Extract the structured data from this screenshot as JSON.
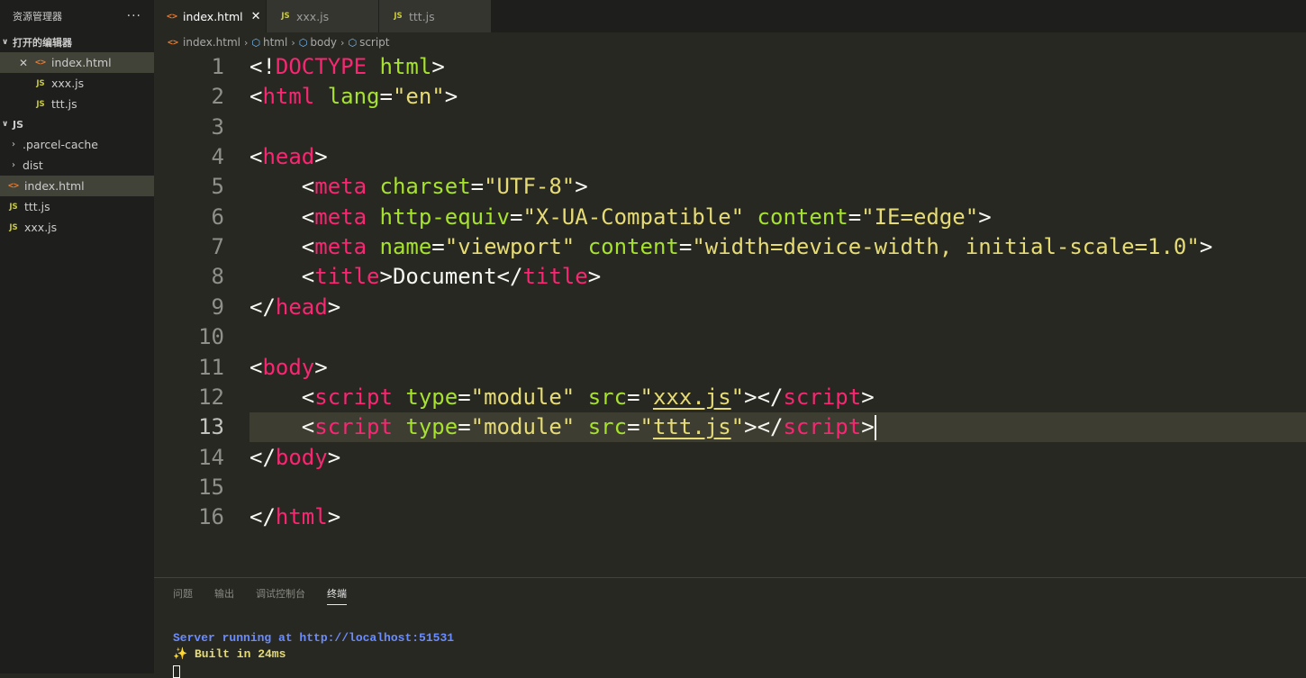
{
  "sidebar": {
    "title": "资源管理器",
    "more": "···",
    "open_editors": {
      "title": "打开的编辑器",
      "items": [
        {
          "name": "index.html",
          "icon": "<>",
          "close": "✕"
        },
        {
          "name": "xxx.js",
          "icon": "JS"
        },
        {
          "name": "ttt.js",
          "icon": "JS"
        }
      ]
    },
    "folder": {
      "title": "JS",
      "items": [
        {
          "name": ".parcel-cache"
        },
        {
          "name": "dist"
        },
        {
          "name": "index.html",
          "icon": "<>"
        },
        {
          "name": "ttt.js",
          "icon": "JS"
        },
        {
          "name": "xxx.js",
          "icon": "JS"
        }
      ]
    }
  },
  "tabs": [
    {
      "label": "index.html",
      "icon": "<>",
      "close": "✕"
    },
    {
      "label": "xxx.js",
      "icon": "JS"
    },
    {
      "label": "ttt.js",
      "icon": "JS"
    }
  ],
  "breadcrumb": [
    "index.html",
    "html",
    "body",
    "script"
  ],
  "editor": {
    "line_numbers": [
      "1",
      "2",
      "3",
      "4",
      "5",
      "6",
      "7",
      "8",
      "9",
      "10",
      "11",
      "12",
      "13",
      "14",
      "15",
      "16"
    ],
    "current_line": "13",
    "lines": [
      [
        "<!",
        "DOCTYPE",
        " ",
        "html",
        ">"
      ],
      [
        "<",
        "html",
        " ",
        "lang",
        "=",
        "\"en\"",
        ">"
      ],
      [],
      [
        "<",
        "head",
        ">"
      ],
      [
        "    <",
        "meta",
        " ",
        "charset",
        "=",
        "\"UTF-8\"",
        ">"
      ],
      [
        "    <",
        "meta",
        " ",
        "http-equiv",
        "=",
        "\"X-UA-Compatible\"",
        " ",
        "content",
        "=",
        "\"IE=edge\"",
        ">"
      ],
      [
        "    <",
        "meta",
        " ",
        "name",
        "=",
        "\"viewport\"",
        " ",
        "content",
        "=",
        "\"width=device-width, initial-scale=1.0\"",
        ">"
      ],
      [
        "    <",
        "title",
        ">",
        "Document",
        "</",
        "title",
        ">"
      ],
      [
        "</",
        "head",
        ">"
      ],
      [],
      [
        "<",
        "body",
        ">"
      ],
      [
        "    <",
        "script",
        " ",
        "type",
        "=",
        "\"module\"",
        " ",
        "src",
        "=",
        "\"",
        "xxx.js",
        "\"",
        "></",
        "script",
        ">"
      ],
      [
        "    <",
        "script",
        " ",
        "type",
        "=",
        "\"module\"",
        " ",
        "src",
        "=",
        "\"",
        "ttt.js",
        "\"",
        "></",
        "script",
        ">"
      ],
      [
        "</",
        "body",
        ">"
      ],
      [],
      [
        "</",
        "html",
        ">"
      ]
    ]
  },
  "panel": {
    "tabs": [
      "问题",
      "输出",
      "调试控制台",
      "终端"
    ],
    "active_tab": "终端",
    "terminal": [
      "Server running at http://localhost:51531",
      "✨ Built in 24ms"
    ]
  }
}
